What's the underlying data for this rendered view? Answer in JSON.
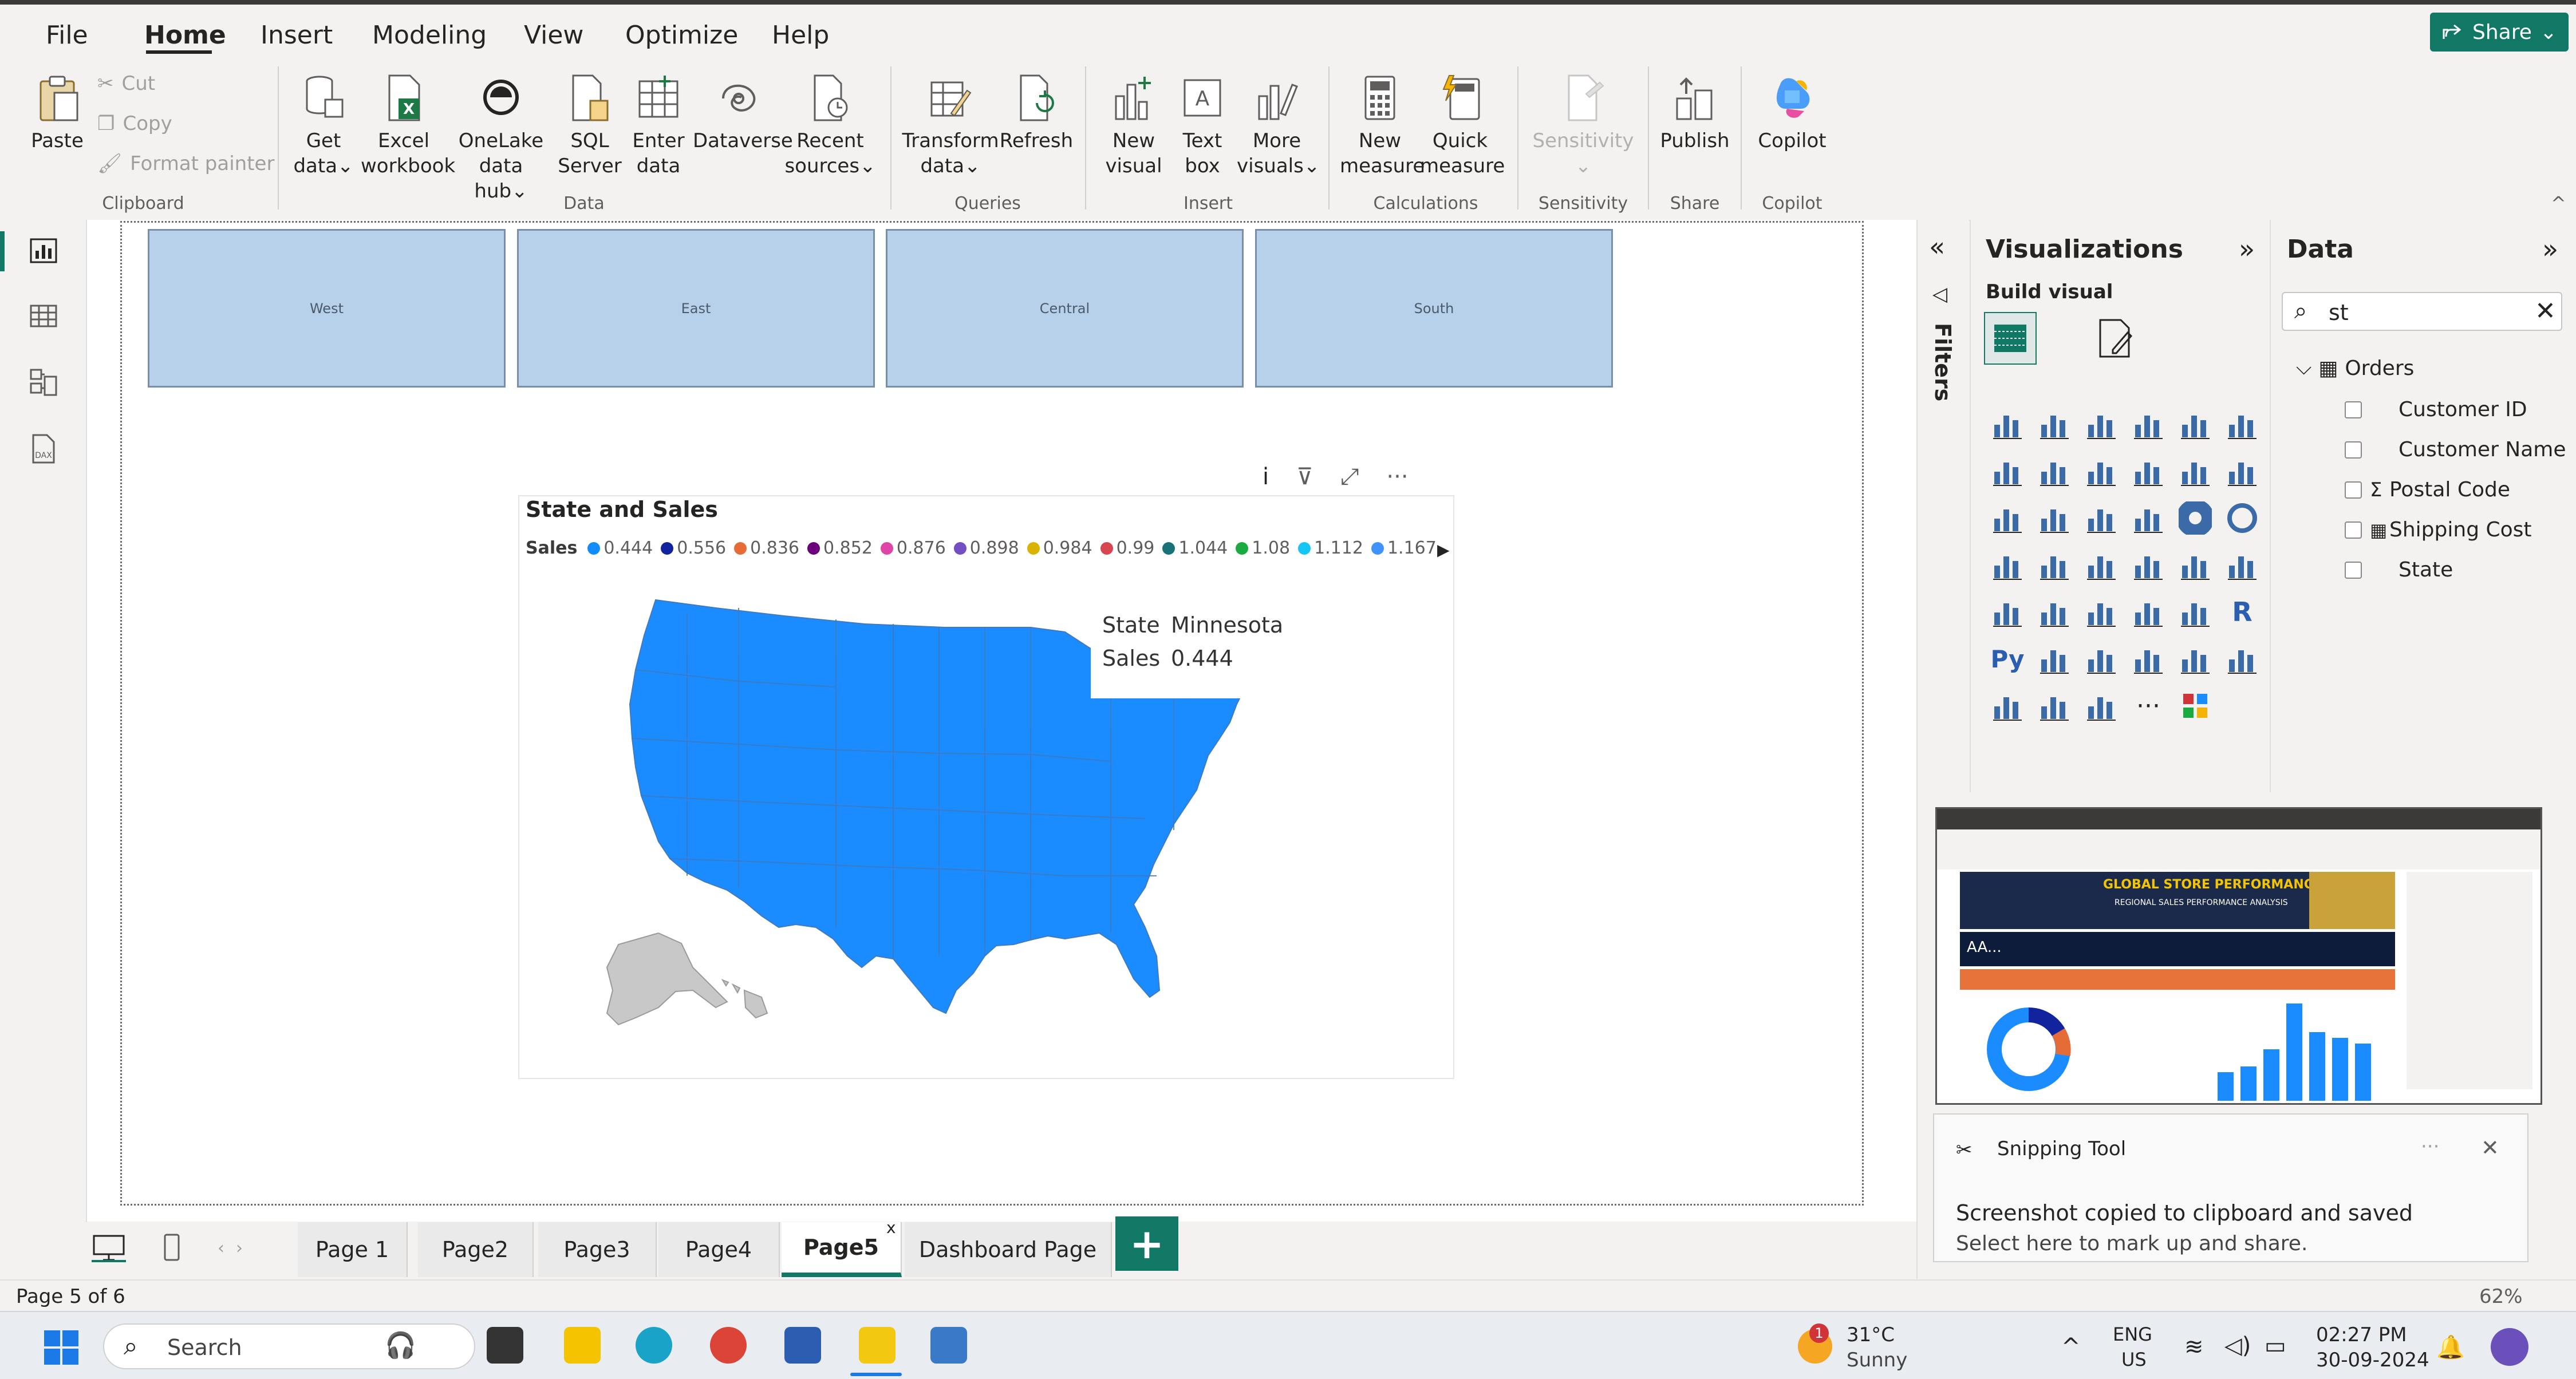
{
  "menu": {
    "items": [
      "File",
      "Home",
      "Insert",
      "Modeling",
      "View",
      "Optimize",
      "Help"
    ],
    "active": "Home",
    "share_label": "Share"
  },
  "ribbon": {
    "clipboard": {
      "paste": "Paste",
      "cut": "Cut",
      "copy": "Copy",
      "format_painter": "Format painter",
      "group": "Clipboard"
    },
    "data": {
      "get_data": [
        "Get",
        "data"
      ],
      "excel": [
        "Excel",
        "workbook"
      ],
      "onelake": [
        "OneLake",
        "data hub"
      ],
      "sql": [
        "SQL",
        "Server"
      ],
      "enter": [
        "Enter",
        "data"
      ],
      "dataverse": "Dataverse",
      "recent": [
        "Recent",
        "sources"
      ],
      "group": "Data"
    },
    "queries": {
      "transform": [
        "Transform",
        "data"
      ],
      "refresh": "Refresh",
      "group": "Queries"
    },
    "insert": {
      "new_visual": [
        "New",
        "visual"
      ],
      "text_box": [
        "Text",
        "box"
      ],
      "more_visuals": [
        "More",
        "visuals"
      ],
      "group": "Insert"
    },
    "calculations": {
      "new_measure": [
        "New",
        "measure"
      ],
      "quick_measure": [
        "Quick",
        "measure"
      ],
      "group": "Calculations"
    },
    "sensitivity": {
      "label": "Sensitivity",
      "group": "Sensitivity"
    },
    "share": {
      "publish": "Publish",
      "group": "Share"
    },
    "copilot": {
      "label": "Copilot",
      "group": "Copilot"
    }
  },
  "canvas": {
    "tiles": [
      "West",
      "East",
      "Central",
      "South"
    ],
    "map": {
      "title": "State and Sales",
      "legend_label": "Sales",
      "legend_values": [
        "0.444",
        "0.556",
        "0.836",
        "0.852",
        "0.876",
        "0.898",
        "0.984",
        "0.99",
        "1.044",
        "1.08",
        "1.112",
        "1.167"
      ],
      "legend_colors": [
        "#118dff",
        "#12239e",
        "#e66c37",
        "#6b007b",
        "#e044a7",
        "#744ec2",
        "#d9b300",
        "#d64550",
        "#197278",
        "#1aab40",
        "#15c6f4",
        "#4092ff"
      ],
      "tooltip": {
        "state_label": "State",
        "state_value": "Minnesota",
        "sales_label": "Sales",
        "sales_value": "0.444"
      },
      "map_color": "#1a8cff"
    }
  },
  "pages": {
    "tabs": [
      "Page 1",
      "Page2",
      "Page3",
      "Page4",
      "Page5",
      "Dashboard Page"
    ],
    "active": "Page5",
    "add": "+",
    "status": "Page 5 of 6"
  },
  "panes": {
    "filters_label": "Filters",
    "visualizations_title": "Visualizations",
    "build_visual": "Build visual",
    "data_title": "Data",
    "search_value": "st",
    "table_name": "Orders",
    "fields": [
      "Customer ID",
      "Customer Name",
      "Postal Code",
      "Shipping Cost",
      "State"
    ]
  },
  "snipping": {
    "app": "Snipping Tool",
    "message": "Screenshot copied to clipboard and saved",
    "sub": "Select here to mark up and share.",
    "thumb_title": "GLOBAL STORE PERFORMANCE",
    "thumb_subtitle": "REGIONAL SALES PERFORMANCE ANALYSIS",
    "thumb_kpi": "AA..."
  },
  "taskbar": {
    "search": "Search",
    "weather_temp": "31°C",
    "weather_desc": "Sunny",
    "weather_badge": "1",
    "lang_top": "ENG",
    "lang_bottom": "US",
    "time": "02:27 PM",
    "date": "30-09-2024"
  },
  "zoom": "62%"
}
